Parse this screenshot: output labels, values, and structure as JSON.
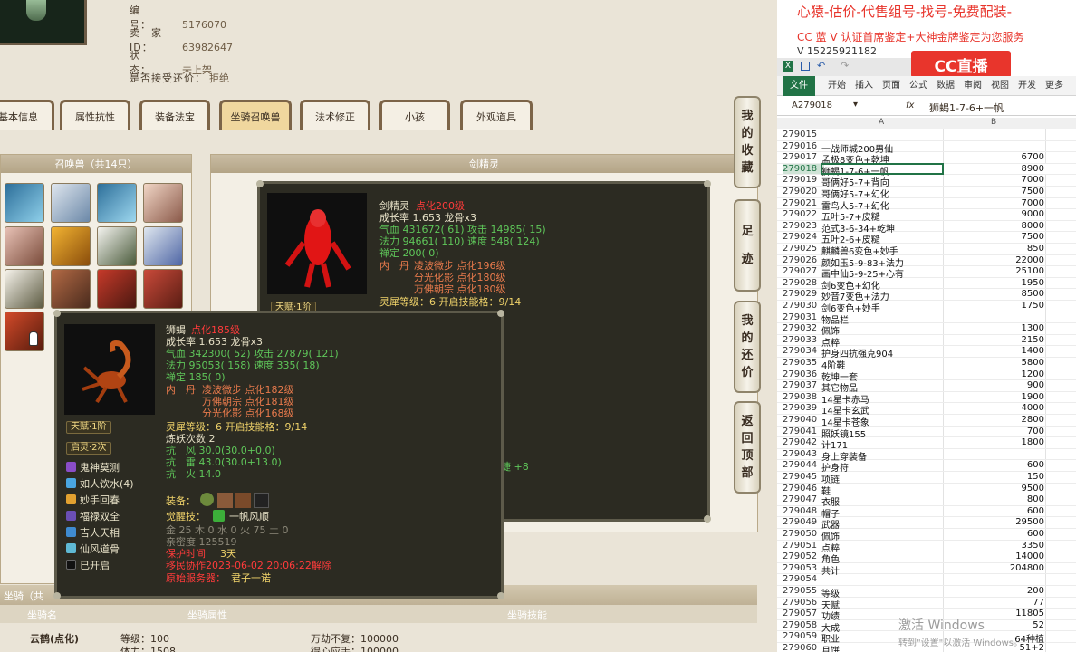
{
  "game": {
    "info": [
      {
        "label": "编　　号：",
        "value": "5176070"
      },
      {
        "label": "卖　家　ID：",
        "value": "63982647"
      },
      {
        "label": "状　　态：",
        "value": "未上架"
      },
      {
        "label": "是否接受还价：",
        "value": "拒绝"
      }
    ],
    "tabs": [
      "基本信息",
      "属性抗性",
      "装备法宝",
      "坐骑召唤兽",
      "法术修正",
      "小孩",
      "外观道具"
    ],
    "active_tab": "坐骑召唤兽",
    "summon_panel_title": "召唤兽（共14只）",
    "summon_detail_title": "剑精灵",
    "side_buttons": [
      {
        "label": [
          "我",
          "的",
          "收",
          "藏"
        ]
      },
      {
        "label": [
          "足",
          "迹"
        ]
      },
      {
        "label": [
          "我",
          "的",
          "还",
          "价"
        ]
      },
      {
        "label": [
          "返",
          "回",
          "顶",
          "部"
        ]
      }
    ],
    "tip1": {
      "name": "剑精灵",
      "level": "点化200级",
      "growth": "成长率 1.653 龙骨x3",
      "hp": "气血 431672( 61) 攻击 14985( 15)",
      "mp": "法力 94661( 110) 速度 548( 124)",
      "zen": "禅定 200( 0)",
      "neidan_label": "内　丹",
      "neidan": [
        "凌波微步 点化196级",
        "分光化影 点化180级",
        "万佛朝宗 点化180级"
      ],
      "lingxi": "灵犀等级：6 开启技能格：9/14",
      "talent": "天赋·1阶",
      "extra": "敏捷 +8"
    },
    "tip2": {
      "name": "狮蝎",
      "level": "点化185级",
      "growth": "成长率 1.653 龙骨x3",
      "hp": "气血 342300( 52) 攻击 27879( 121)",
      "mp": "法力 95053( 158) 速度 335( 18)",
      "zen": "禅定 185( 0)",
      "neidan_label": "内　丹",
      "neidan": [
        "凌波微步 点化182级",
        "万佛朝宗 点化181级",
        "分光化影 点化168级"
      ],
      "lingxi": "灵犀等级：6 开启技能格：9/14",
      "refine": "炼妖次数 2",
      "resist": [
        "抗　风 30.0(30.0+0.0)",
        "抗　雷 43.0(30.0+13.0)",
        "抗　火 14.0"
      ],
      "badges": [
        "天赋·1阶",
        "启灵·2次"
      ],
      "skills": [
        "鬼神莫测",
        "如人饮水(4)",
        "妙手回春",
        "福禄双全",
        "吉人天相",
        "仙风道骨",
        "已开启"
      ],
      "equip_label": "装备：",
      "awaken_label": "觉醒技：",
      "awaken": "一帆风顺",
      "elements": "金 25 木 0 水 0 火 75 土 0",
      "intimacy": "亲密度 125519",
      "protect_label": "保护时间",
      "protect_val": "3天",
      "migrate": "移民协作2023-06-02 20:06:22解除",
      "server_label": "原始服务器：",
      "server_val": "君子一诺"
    },
    "mount_head": "坐骑（共",
    "bottom_cols": [
      "坐骑名",
      "坐骑属性",
      "坐骑技能"
    ],
    "mount_name": "云鹤(点化)",
    "mount_attrs": [
      "等级：100",
      "体力：1508"
    ],
    "mount_skills": [
      "万劫不复：100000",
      "得心应手：100000"
    ]
  },
  "excel": {
    "ad_lines": [
      "心猿-估价-代售组号-找号-免费配装-",
      "CC 蓝 V 认证首席鉴定+大神金牌鉴定为您服务",
      "V 15225921182"
    ],
    "ad_logo": "CC直播",
    "ribbon_tabs": [
      "文件",
      "开始",
      "插入",
      "页面",
      "公式",
      "数据",
      "审阅",
      "视图",
      "开发",
      "更多"
    ],
    "name_box": "A279018",
    "fx": "fx",
    "formula": "狮蝎1-7-6+一帆",
    "col_headers": [
      "A",
      "B"
    ],
    "rows": [
      {
        "n": "279015",
        "a": "",
        "b": ""
      },
      {
        "n": "279016",
        "a": "一战师城200男仙",
        "b": ""
      },
      {
        "n": "279017",
        "a": "孟极8变色+乾坤",
        "b": "6700"
      },
      {
        "n": "279018",
        "a": "狮蝎1-7-6+一帆",
        "b": "8900"
      },
      {
        "n": "279019",
        "a": "哥俩好5-7+背向",
        "b": "7000"
      },
      {
        "n": "279020",
        "a": "哥俩好5-7+幻化",
        "b": "7500"
      },
      {
        "n": "279021",
        "a": "雷鸟人5-7+幻化",
        "b": "7000"
      },
      {
        "n": "279022",
        "a": "五叶5-7+皮糙",
        "b": "9000"
      },
      {
        "n": "279023",
        "a": "范式3-6-34+乾坤",
        "b": "8000"
      },
      {
        "n": "279024",
        "a": "五叶2-6+皮糙",
        "b": "7500"
      },
      {
        "n": "279025",
        "a": "麒麟兽6变色+妙手",
        "b": "850"
      },
      {
        "n": "279026",
        "a": "颜如玉5-9-83+法力",
        "b": "22000"
      },
      {
        "n": "279027",
        "a": "画中仙5-9-25+心有",
        "b": "25100"
      },
      {
        "n": "279028",
        "a": "剑6变色+幻化",
        "b": "1950"
      },
      {
        "n": "279029",
        "a": "妙音7变色+法力",
        "b": "8500"
      },
      {
        "n": "279030",
        "a": "剑6变色+妙手",
        "b": "1750"
      },
      {
        "n": "279031",
        "a": "物品栏",
        "b": ""
      },
      {
        "n": "279032",
        "a": "佩饰",
        "b": "1300"
      },
      {
        "n": "279033",
        "a": "点粹",
        "b": "2150"
      },
      {
        "n": "279034",
        "a": "护身四抗强克904",
        "b": "1400"
      },
      {
        "n": "279035",
        "a": "4阶鞋",
        "b": "5800"
      },
      {
        "n": "279036",
        "a": "乾坤一套",
        "b": "1200"
      },
      {
        "n": "279037",
        "a": "其它物品",
        "b": "900"
      },
      {
        "n": "279038",
        "a": "14星卡赤马",
        "b": "1900"
      },
      {
        "n": "279039",
        "a": "14星卡玄武",
        "b": "4000"
      },
      {
        "n": "279040",
        "a": "14星卡苍象",
        "b": "2800"
      },
      {
        "n": "279041",
        "a": "照妖镜155",
        "b": "700"
      },
      {
        "n": "279042",
        "a": "计171",
        "b": "1800"
      },
      {
        "n": "279043",
        "a": "身上穿装备",
        "b": ""
      },
      {
        "n": "279044",
        "a": "护身符",
        "b": "600"
      },
      {
        "n": "279045",
        "a": "项链",
        "b": "150"
      },
      {
        "n": "279046",
        "a": "鞋",
        "b": "9500"
      },
      {
        "n": "279047",
        "a": "衣服",
        "b": "800"
      },
      {
        "n": "279048",
        "a": "帽子",
        "b": "600"
      },
      {
        "n": "279049",
        "a": "武器",
        "b": "29500"
      },
      {
        "n": "279050",
        "a": "佩饰",
        "b": "600"
      },
      {
        "n": "279051",
        "a": "点粹",
        "b": "3350"
      },
      {
        "n": "279052",
        "a": "角色",
        "b": "14000"
      },
      {
        "n": "279053",
        "a": "共计",
        "b": "204800"
      },
      {
        "n": "279054",
        "a": "",
        "b": ""
      },
      {
        "n": "279055",
        "a": "等级",
        "b": "200"
      },
      {
        "n": "279056",
        "a": "天赋",
        "b": "77"
      },
      {
        "n": "279057",
        "a": "功绩",
        "b": "11805"
      },
      {
        "n": "279058",
        "a": "大成",
        "b": "52"
      },
      {
        "n": "279059",
        "a": "职业",
        "b": "64种植"
      },
      {
        "n": "279060",
        "a": "月饼",
        "b": "51+2"
      }
    ],
    "watermark": [
      "激活 Windows",
      "转到\"设置\"以激活 Windows。"
    ]
  },
  "colors": {
    "excel_green": "#217346",
    "game_frame": "#7c6448",
    "tip_bg": "#2c2b22",
    "ad_red": "#e8352c"
  }
}
